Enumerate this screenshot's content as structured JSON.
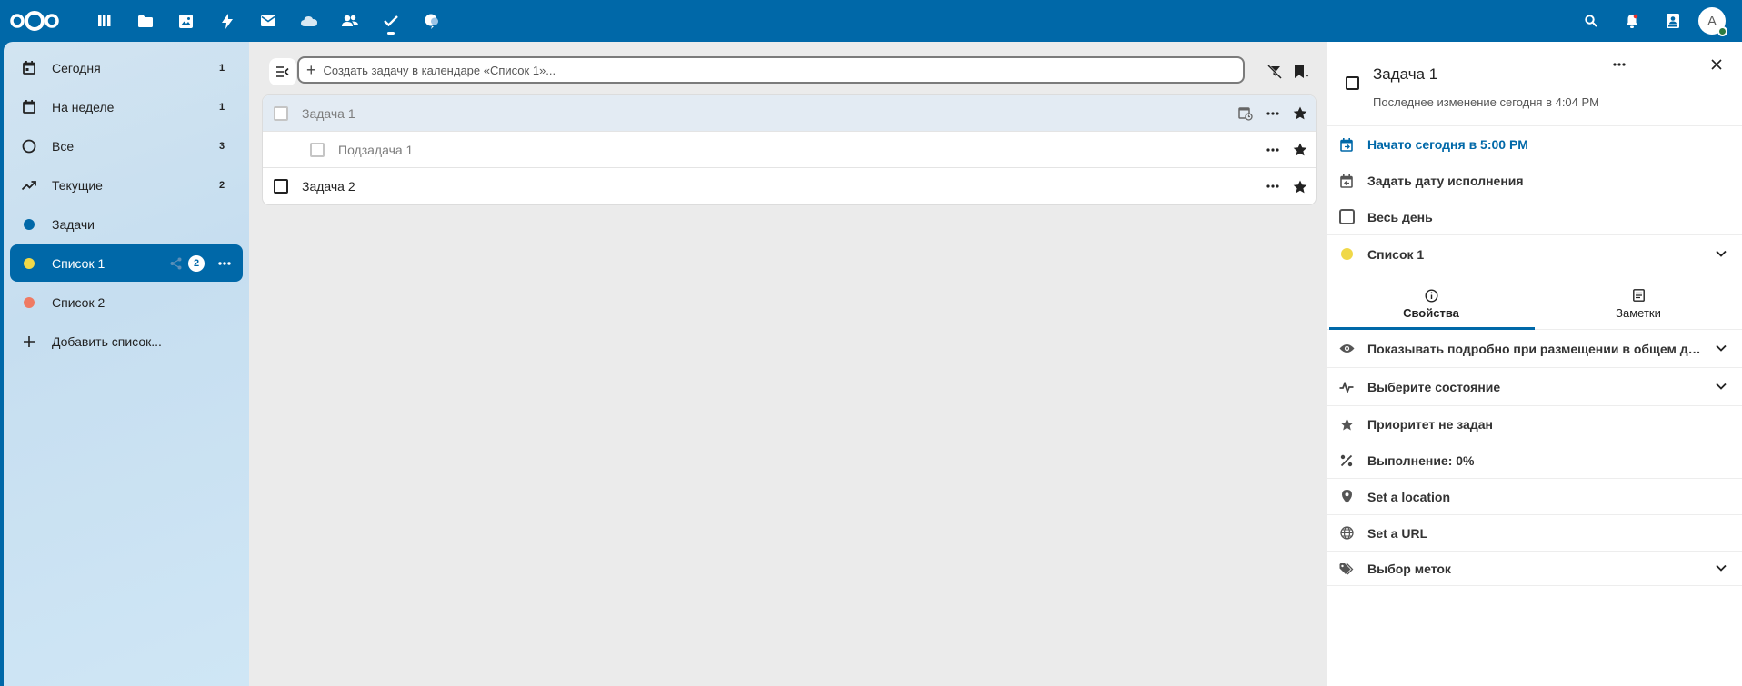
{
  "header": {
    "apps": [
      {
        "icon": "dashboard-icon",
        "active": false
      },
      {
        "icon": "files-icon",
        "active": false
      },
      {
        "icon": "photos-icon",
        "active": false
      },
      {
        "icon": "activity-icon",
        "active": false
      },
      {
        "icon": "mail-icon",
        "active": false
      },
      {
        "icon": "cloud-icon",
        "active": false
      },
      {
        "icon": "contacts-icon",
        "active": false
      },
      {
        "icon": "tasks-icon",
        "active": true
      },
      {
        "icon": "notes-icon",
        "active": false
      }
    ],
    "avatar_letter": "A"
  },
  "sidebar": {
    "items": [
      {
        "label": "Сегодня",
        "count": "1",
        "icon": "calendar-today-icon"
      },
      {
        "label": "На неделе",
        "count": "1",
        "icon": "calendar-week-icon"
      },
      {
        "label": "Все",
        "count": "3",
        "icon": "circle-outline-icon"
      },
      {
        "label": "Текущие",
        "count": "2",
        "icon": "trending-icon"
      },
      {
        "label": "Задачи",
        "count": "",
        "icon": "dot-icon",
        "color": "#0068a8"
      },
      {
        "label": "Список 1",
        "count": "2",
        "icon": "dot-icon",
        "color": "#f0d848",
        "active": true
      },
      {
        "label": "Список 2",
        "count": "",
        "icon": "dot-icon",
        "color": "#ef7a63"
      },
      {
        "label": "Добавить список...",
        "count": "",
        "icon": "plus-icon"
      }
    ]
  },
  "main": {
    "new_task_placeholder": "Создать задачу в календаре «Список 1»...",
    "tasks": [
      {
        "label": "Задача 1",
        "selected": true,
        "faded": true,
        "sub": false,
        "has_date_icon": true
      },
      {
        "label": "Подзадача 1",
        "selected": false,
        "faded": true,
        "sub": true,
        "has_date_icon": false
      },
      {
        "label": "Задача 2",
        "selected": false,
        "faded": false,
        "sub": false,
        "has_date_icon": false
      }
    ]
  },
  "panel": {
    "title": "Задача 1",
    "subtitle": "Последнее изменение сегодня в 4:04 PM",
    "start": "Начато сегодня в 5:00 PM",
    "due": "Задать дату исполнения",
    "all_day": "Весь день",
    "calendar": "Список 1",
    "calendar_color": "#f0d848",
    "tabs": {
      "properties": "Свойства",
      "notes": "Заметки"
    },
    "rows": {
      "show_details": "Показывать подробно при размещении в общем доступе",
      "status": "Выберите состояние",
      "priority": "Приоритет не задан",
      "completion": "Выполнение: 0%",
      "location": "Set a location",
      "url": "Set a URL",
      "tags": "Выбор меток"
    }
  }
}
